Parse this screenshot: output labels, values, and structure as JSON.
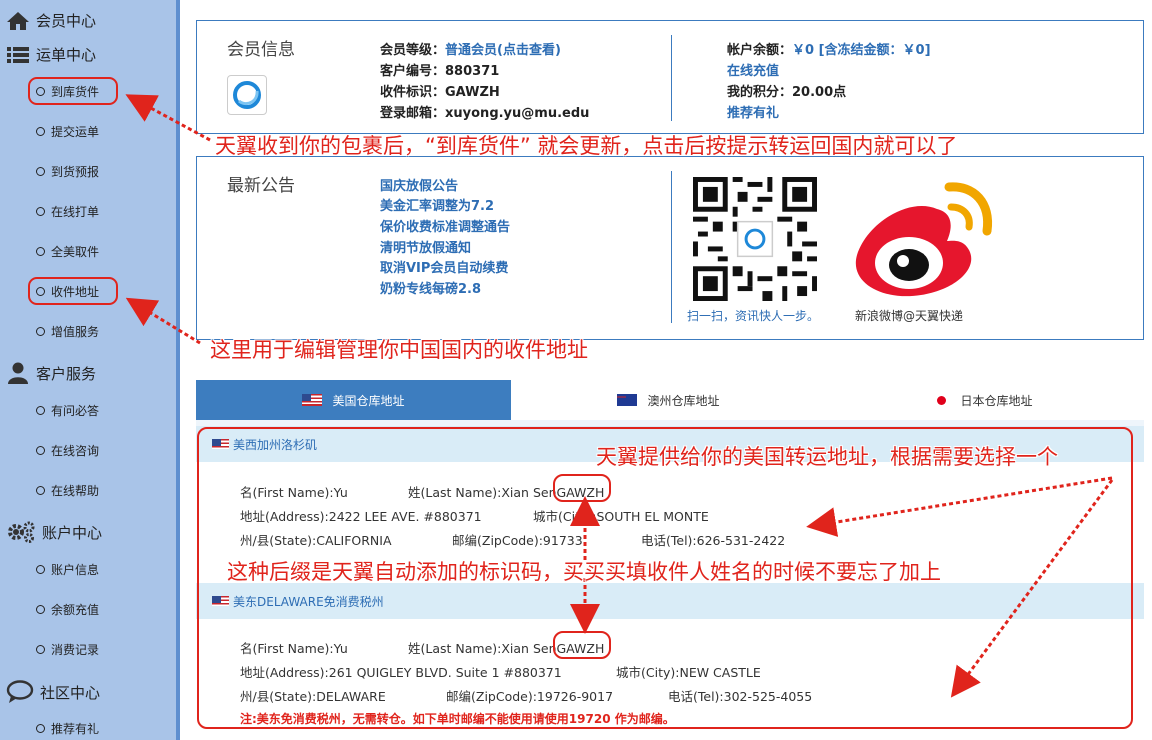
{
  "sidebar": {
    "sections": [
      {
        "title": "会员中心",
        "items": []
      },
      {
        "title": "运单中心",
        "items": [
          "到库货件",
          "提交运单",
          "到货预报",
          "在线打单",
          "全美取件",
          "收件地址",
          "增值服务"
        ]
      },
      {
        "title": "客户服务",
        "items": [
          "有问必答",
          "在线咨询",
          "在线帮助"
        ]
      },
      {
        "title": "账户中心",
        "items": [
          "账户信息",
          "余额充值",
          "消费记录"
        ]
      },
      {
        "title": "社区中心",
        "items": [
          "推荐有礼"
        ]
      }
    ]
  },
  "member": {
    "title": "会员信息",
    "level_label": "会员等级：",
    "level_value": "普通会员(点击查看)",
    "id_label": "客户编号：",
    "id_value": "880371",
    "tag_label": "收件标识：",
    "tag_value": "GAWZH",
    "email_label": "登录邮箱：",
    "email_value": "xuyong.yu@mu.edu",
    "balance_label": "帐户余额：",
    "balance_value": "￥0 [含冻结金额：￥0]",
    "recharge_link": "在线充值",
    "points_label": "我的积分：",
    "points_value": "20.00点",
    "referral_link": "推荐有礼"
  },
  "announcements": {
    "title": "最新公告",
    "items": [
      "国庆放假公告",
      "美金汇率调整为7.2",
      "保价收费标准调整通告",
      "清明节放假通知",
      "取消VIP会员自动续费",
      "奶粉专线每磅2.8"
    ],
    "qr_caption": "扫一扫，资讯快人一步。",
    "weibo_caption": "新浪微博@天翼快递"
  },
  "tabs": [
    "美国仓库地址",
    "澳州仓库地址",
    "日本仓库地址"
  ],
  "addresses": [
    {
      "header": "美西加州洛杉矶",
      "first_name": "名(First Name):Yu",
      "last_name": "姓(Last Name):Xian Sen",
      "suffix": "GAWZH",
      "address": "地址(Address):2422 LEE AVE. #880371",
      "city": "城市(City):SOUTH EL MONTE",
      "state": "州/县(State):CALIFORNIA",
      "zip": "邮编(ZipCode):91733",
      "tel": "电话(Tel):626-531-2422"
    },
    {
      "header": "美东DELAWARE免消费税州",
      "first_name": "名(First Name):Yu",
      "last_name": "姓(Last Name):Xian Sen",
      "suffix": "GAWZH",
      "address": "地址(Address):261 QUIGLEY BLVD. Suite 1 #880371",
      "city": "城市(City):NEW CASTLE",
      "state": "州/县(State):DELAWARE",
      "zip": "邮编(ZipCode):19726-9017",
      "tel": "电话(Tel):302-525-4055",
      "note": "注:美东免消费税州，无需转仓。如下单时邮编不能使用请使用19720 作为邮编。"
    }
  ],
  "annotations": {
    "a1": "天翼收到你的包裹后，“到库货件” 就会更新，点击后按提示转运回国内就可以了",
    "a2": "这里用于编辑管理你中国国内的收件地址",
    "a3": "天翼提供给你的美国转运地址，根据需要选择一个",
    "a4": "这种后缀是天翼自动添加的标识码，买买买填收件人姓名的时候不要忘了加上"
  },
  "colors": {
    "sidebar_bg": "#a9c4e8",
    "accent_blue": "#3c7bbf",
    "link_blue": "#2d6db4",
    "annotation_red": "#e0241c",
    "active_tab": "#3d7dbf"
  }
}
